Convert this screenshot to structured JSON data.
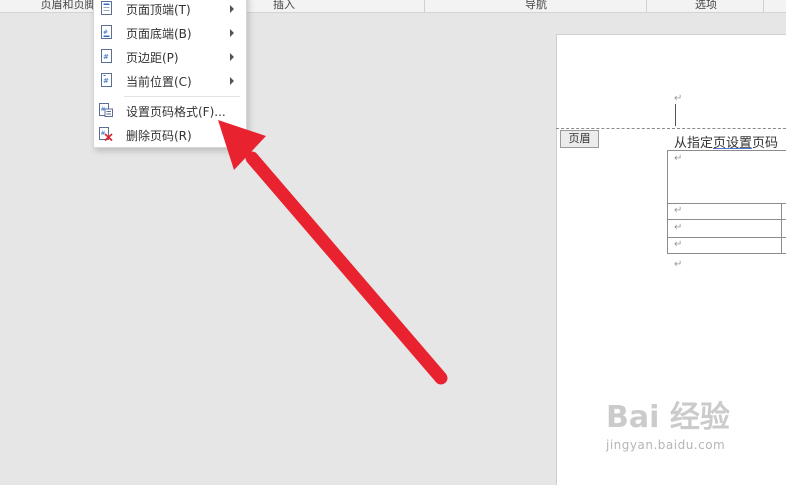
{
  "ribbon": {
    "groups": [
      "页眉和页脚",
      "插入",
      "导航",
      "选项"
    ]
  },
  "menu": {
    "items": [
      {
        "label": "页面顶端(T)",
        "icon": "page-top-icon",
        "has_submenu": true
      },
      {
        "label": "页面底端(B)",
        "icon": "page-bottom-icon",
        "has_submenu": true
      },
      {
        "label": "页边距(P)",
        "icon": "page-margin-icon",
        "has_submenu": true
      },
      {
        "label": "当前位置(C)",
        "icon": "current-position-icon",
        "has_submenu": true
      },
      {
        "label": "设置页码格式(F)...",
        "icon": "format-page-number-icon",
        "has_submenu": false
      },
      {
        "label": "删除页码(R)",
        "icon": "remove-page-number-icon",
        "has_submenu": false
      }
    ]
  },
  "document": {
    "header_tag": "页眉",
    "header_text_before": "从指定",
    "header_text_link": "页设置",
    "header_text_after": "页码",
    "pilcrow": "↵"
  },
  "annotation": {
    "color": "#e8232f"
  },
  "watermark": {
    "main": "Bai 经验",
    "sub": "jingyan.baidu.com"
  }
}
